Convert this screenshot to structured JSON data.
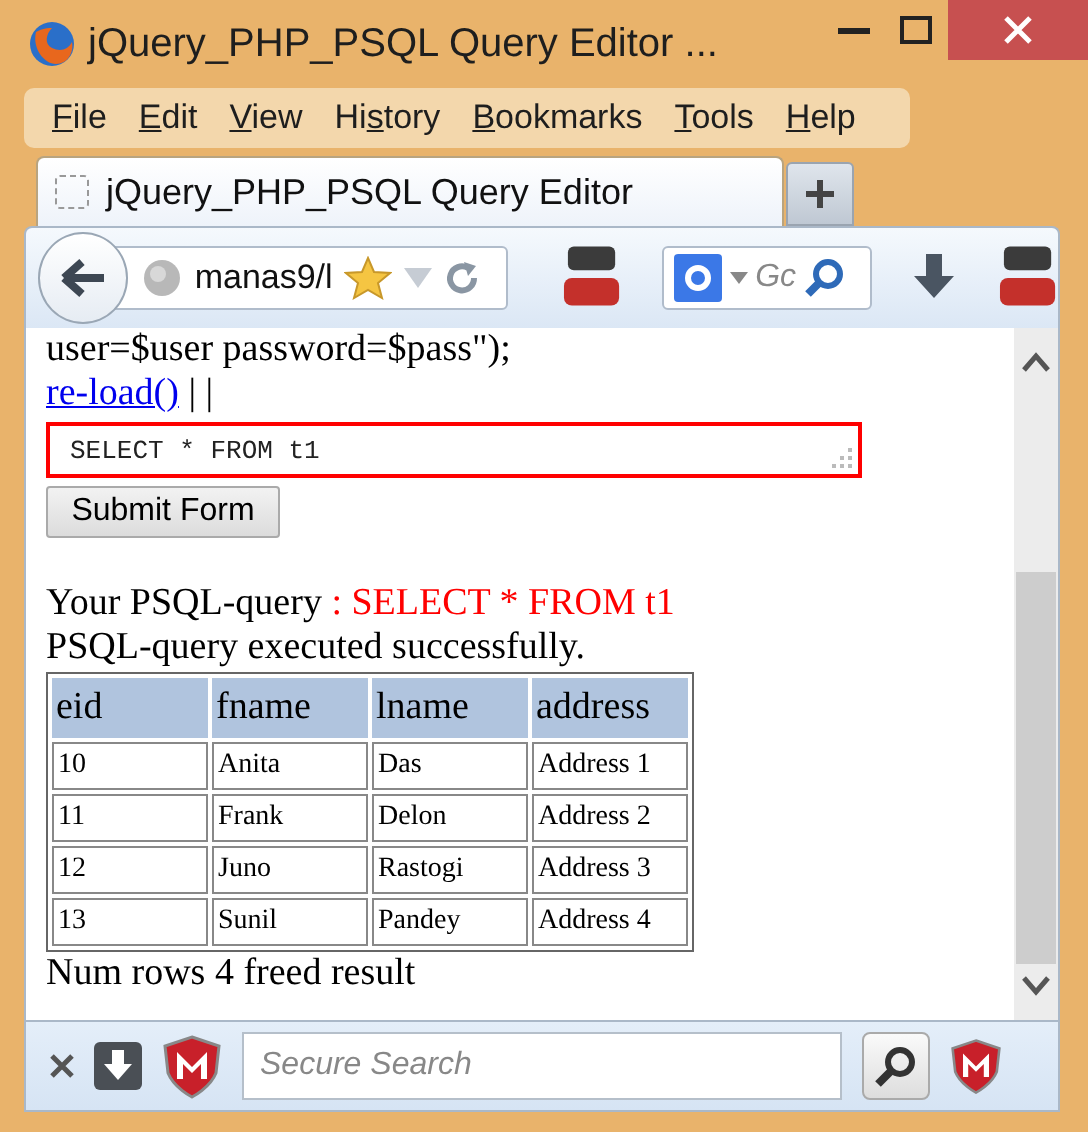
{
  "window": {
    "title": "jQuery_PHP_PSQL Query Editor ..."
  },
  "menu": [
    {
      "key": "F",
      "after": "ile"
    },
    {
      "key": "E",
      "after": "dit"
    },
    {
      "key": "V",
      "after": "iew"
    },
    {
      "before": "Hi",
      "key": "s",
      "after": "tory"
    },
    {
      "key": "B",
      "after": "ookmarks"
    },
    {
      "key": "T",
      "after": "ools"
    },
    {
      "key": "H",
      "after": "elp"
    }
  ],
  "tabs": [
    {
      "label": "jQuery_PHP_PSQL Query Editor",
      "selected": true
    }
  ],
  "nav": {
    "url": "manas9/l",
    "search_placeholder": "Gc"
  },
  "page": {
    "code_line": "user=$user password=$pass\");",
    "link": "re-load()",
    "separator": "| |",
    "query_value": "SELECT * FROM t1",
    "submit": "Submit Form",
    "query_label": "Your PSQL-query",
    "query_echo": ": SELECT * FROM t1",
    "status": "PSQL-query executed successfully.",
    "table": {
      "columns": [
        "eid",
        "fname",
        "lname",
        "address"
      ],
      "rows": [
        [
          "10",
          "Anita",
          "Das",
          "Address 1"
        ],
        [
          "11",
          "Frank",
          "Delon",
          "Address 2"
        ],
        [
          "12",
          "Juno",
          "Rastogi",
          "Address 3"
        ],
        [
          "13",
          "Sunil",
          "Pandey",
          "Address 4"
        ]
      ]
    },
    "footer": "Num rows 4 freed result"
  },
  "bottom_bar": {
    "search_placeholder": "Secure Search"
  }
}
